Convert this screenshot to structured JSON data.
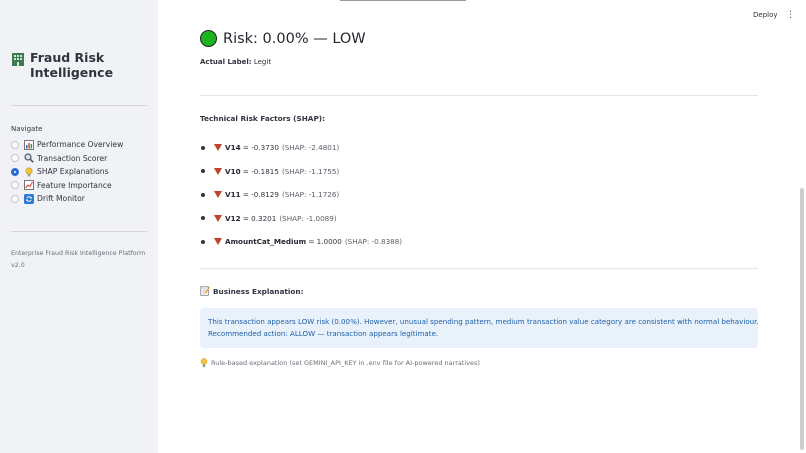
{
  "sidebar": {
    "app_title": "Fraud Risk Intelligence",
    "nav_label": "Navigate",
    "nav_items": [
      {
        "label": "Performance Overview",
        "icon": "bar-chart-icon",
        "selected": false
      },
      {
        "label": "Transaction Scorer",
        "icon": "magnifier-icon",
        "selected": false
      },
      {
        "label": "SHAP Explanations",
        "icon": "lightbulb-icon",
        "selected": true
      },
      {
        "label": "Feature Importance",
        "icon": "line-chart-icon",
        "selected": false
      },
      {
        "label": "Drift Monitor",
        "icon": "refresh-icon",
        "selected": false
      }
    ],
    "footer": "Enterprise Fraud Risk Intelligence Platform v2.0"
  },
  "header": {
    "deploy_label": "Deploy"
  },
  "main": {
    "risk_heading": "Risk: 0.00% — LOW",
    "actual_label_key": "Actual Label:",
    "actual_label_value": "Legit",
    "factors_title": "Technical Risk Factors (SHAP):",
    "factors": [
      {
        "name": "V14",
        "value": "= -0.3730",
        "shap": "(SHAP: -2.4801)"
      },
      {
        "name": "V10",
        "value": "= -0.1815",
        "shap": "(SHAP: -1.1755)"
      },
      {
        "name": "V11",
        "value": "= -0.8129",
        "shap": "(SHAP: -1.1726)"
      },
      {
        "name": "V12",
        "value": "= 0.3201",
        "shap": "(SHAP: -1.0089)"
      },
      {
        "name": "AmountCat_Medium",
        "value": "= 1.0000",
        "shap": "(SHAP: -0.8388)"
      }
    ],
    "business_title": "Business Explanation:",
    "explanation_line1": "This transaction appears LOW risk (0.00%). However, unusual spending pattern, medium transaction value category are consistent with normal behaviour.",
    "explanation_line2": "Recommended action: ALLOW — transaction appears legitimate.",
    "note": "Rule-based explanation (set GEMINI_API_KEY in .env file for AI-powered narratives)"
  },
  "colors": {
    "risk_indicator": "#1cb41c",
    "factor_arrow": "#c2412d",
    "info_bg": "#e9f2fb",
    "info_text": "#1d5fa8",
    "selected_radio": "#2f6cd6"
  }
}
